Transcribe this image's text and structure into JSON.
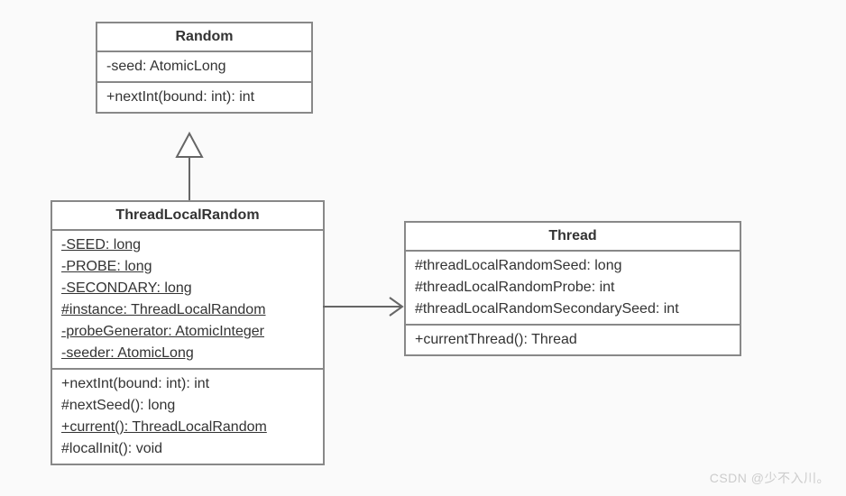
{
  "classes": {
    "random": {
      "name": "Random",
      "attributes": [
        "-seed: AtomicLong"
      ],
      "methods": [
        "+nextInt(bound: int): int"
      ]
    },
    "threadLocalRandom": {
      "name": "ThreadLocalRandom",
      "attributes": [
        {
          "text": "-SEED: long",
          "static": true
        },
        {
          "text": "-PROBE: long",
          "static": true
        },
        {
          "text": "-SECONDARY: long",
          "static": true
        },
        {
          "text": "#instance: ThreadLocalRandom",
          "static": true
        },
        {
          "text": "-probeGenerator: AtomicInteger",
          "static": true
        },
        {
          "text": "-seeder: AtomicLong",
          "static": true
        }
      ],
      "methods": [
        {
          "text": "+nextInt(bound: int): int",
          "static": false
        },
        {
          "text": "#nextSeed(): long",
          "static": false
        },
        {
          "text": "+current(): ThreadLocalRandom",
          "static": true
        },
        {
          "text": "#localInit(): void",
          "static": false
        }
      ]
    },
    "thread": {
      "name": "Thread",
      "attributes": [
        "#threadLocalRandomSeed: long",
        "#threadLocalRandomProbe: int",
        "#threadLocalRandomSecondarySeed: int"
      ],
      "methods": [
        "+currentThread(): Thread"
      ]
    }
  },
  "relations": [
    {
      "type": "generalization",
      "from": "threadLocalRandom",
      "to": "random"
    },
    {
      "type": "association",
      "from": "threadLocalRandom",
      "to": "thread"
    }
  ],
  "watermark": "CSDN @少不入川。"
}
